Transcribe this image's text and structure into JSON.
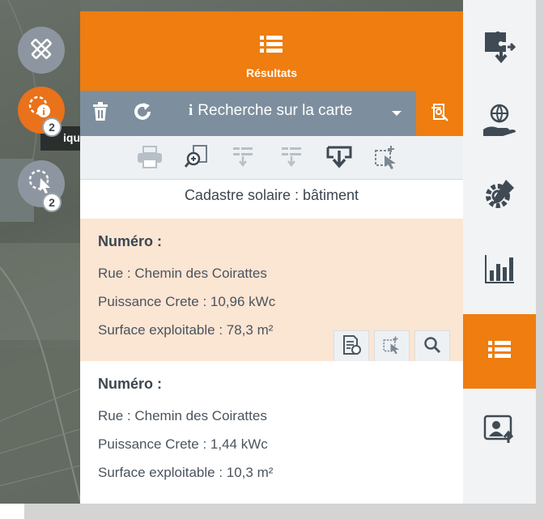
{
  "panel": {
    "title": "Résultats",
    "title_icon": "list-icon",
    "search_select": {
      "info_glyph": "i",
      "selected": "Recherche sur la carte"
    },
    "layer_title": "Cadastre solaire : bâtiment",
    "results": [
      {
        "title": "Numéro :",
        "lines": [
          "Rue : Chemin des Coirattes",
          "Puissance Crete : 10,96 kWc",
          "Surface exploitable : 78,3 m²"
        ],
        "highlighted": true
      },
      {
        "title": "Numéro :",
        "lines": [
          "Rue : Chemin des Coirattes",
          "Puissance Crete : 1,44 kWc",
          "Surface exploitable : 10,3 m²"
        ],
        "highlighted": false
      }
    ]
  },
  "map_tools": [
    {
      "icon": "ruler-pencil-icon",
      "badge": ""
    },
    {
      "icon": "info-select-icon",
      "badge": "2"
    },
    {
      "icon": "pointer-select-icon",
      "badge": "2"
    }
  ],
  "map_tooltip_fragment": "iqu",
  "sidebar": {
    "items": [
      {
        "icon": "puzzle-icon",
        "active": false
      },
      {
        "icon": "globe-hand-icon",
        "active": false
      },
      {
        "icon": "gear-pencil-icon",
        "active": false
      },
      {
        "icon": "bar-chart-icon",
        "active": false
      },
      {
        "icon": "list-icon",
        "active": true
      },
      {
        "icon": "user-upload-icon",
        "active": false
      }
    ]
  },
  "colors": {
    "accent": "#ef7d0f",
    "search_bar": "#7d8f9e",
    "highlight_row": "#fbe5d3",
    "text": "#3c4650"
  }
}
